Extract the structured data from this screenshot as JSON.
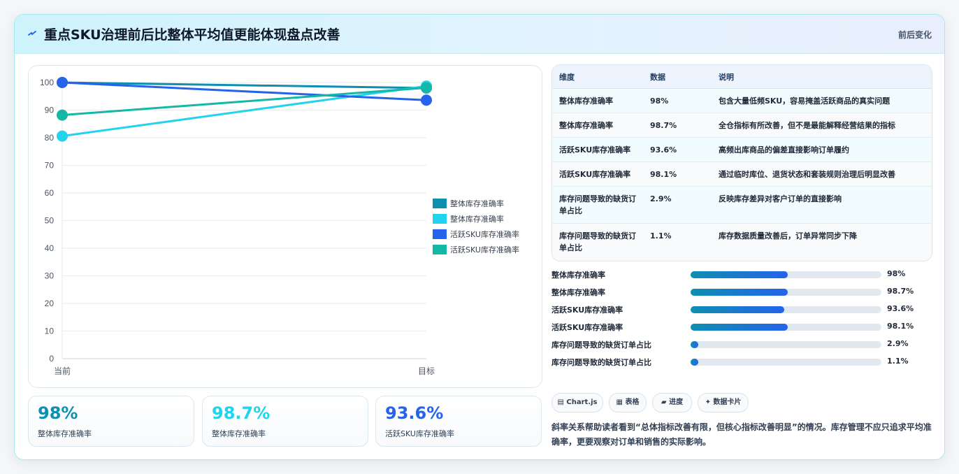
{
  "header": {
    "title": "重点SKU治理前后比整体平均值更能体现盘点改善",
    "right_label": "前后变化",
    "icon": "lightning-icon"
  },
  "chart_data": {
    "type": "line",
    "categories": [
      "当前",
      "目标"
    ],
    "ylim": [
      0,
      100
    ],
    "yticks": [
      0,
      10,
      20,
      30,
      40,
      50,
      60,
      70,
      80,
      90,
      100
    ],
    "series": [
      {
        "name": "整体库存准确率",
        "values": [
          100,
          98
        ],
        "color": "#0e8fb0"
      },
      {
        "name": "整体库存准确率",
        "values": [
          80.6,
          98.7
        ],
        "color": "#22d3ee"
      },
      {
        "name": "活跃SKU库存准确率",
        "values": [
          100,
          93.6
        ],
        "color": "#2563eb"
      },
      {
        "name": "活跃SKU库存准确率",
        "values": [
          88.2,
          98.1
        ],
        "color": "#14b8a6"
      }
    ],
    "legend_position": "right",
    "grid": true
  },
  "kpis": [
    {
      "value": "98%",
      "label": "整体库存准确率",
      "color": "#0e8fb0"
    },
    {
      "value": "98.7%",
      "label": "整体库存准确率",
      "color": "#22d3ee"
    },
    {
      "value": "93.6%",
      "label": "活跃SKU库存准确率",
      "color": "#2563eb"
    }
  ],
  "table": {
    "headers": [
      "维度",
      "数据",
      "说明"
    ],
    "rows": [
      {
        "dim": "整体库存准确率",
        "val": "98%",
        "desc": "包含大量低频SKU，容易掩盖活跃商品的真实问题"
      },
      {
        "dim": "整体库存准确率",
        "val": "98.7%",
        "desc": "全仓指标有所改善，但不是最能解释经营结果的指标"
      },
      {
        "dim": "活跃SKU库存准确率",
        "val": "93.6%",
        "desc": "高频出库商品的偏差直接影响订单履约"
      },
      {
        "dim": "活跃SKU库存准确率",
        "val": "98.1%",
        "desc": "通过临时库位、退货状态和套装规则治理后明显改善"
      },
      {
        "dim": "库存问题导致的缺货订单占比",
        "val": "2.9%",
        "desc": "反映库存差异对客户订单的直接影响"
      },
      {
        "dim": "库存问题导致的缺货订单占比",
        "val": "1.1%",
        "desc": "库存数据质量改善后，订单异常同步下降"
      }
    ]
  },
  "progress": [
    {
      "label": "整体库存准确率",
      "pct": "98%",
      "fraction": 0.51
    },
    {
      "label": "整体库存准确率",
      "pct": "98.7%",
      "fraction": 0.51
    },
    {
      "label": "活跃SKU库存准确率",
      "pct": "93.6%",
      "fraction": 0.49
    },
    {
      "label": "活跃SKU库存准确率",
      "pct": "98.1%",
      "fraction": 0.51
    },
    {
      "label": "库存问题导致的缺货订单占比",
      "pct": "2.9%",
      "fraction": 0.04
    },
    {
      "label": "库存问题导致的缺货订单占比",
      "pct": "1.1%",
      "fraction": 0.04
    }
  ],
  "tags": [
    {
      "label": "▤ Chart.js"
    },
    {
      "label": "▦ 表格"
    },
    {
      "label": "▰ 进度"
    },
    {
      "label": "✦ 数据卡片"
    }
  ],
  "note": "斜率关系帮助读者看到“总体指标改善有限，但核心指标改善明显”的情况。库存管理不应只追求平均准确率，更要观察对订单和销售的实际影响。"
}
